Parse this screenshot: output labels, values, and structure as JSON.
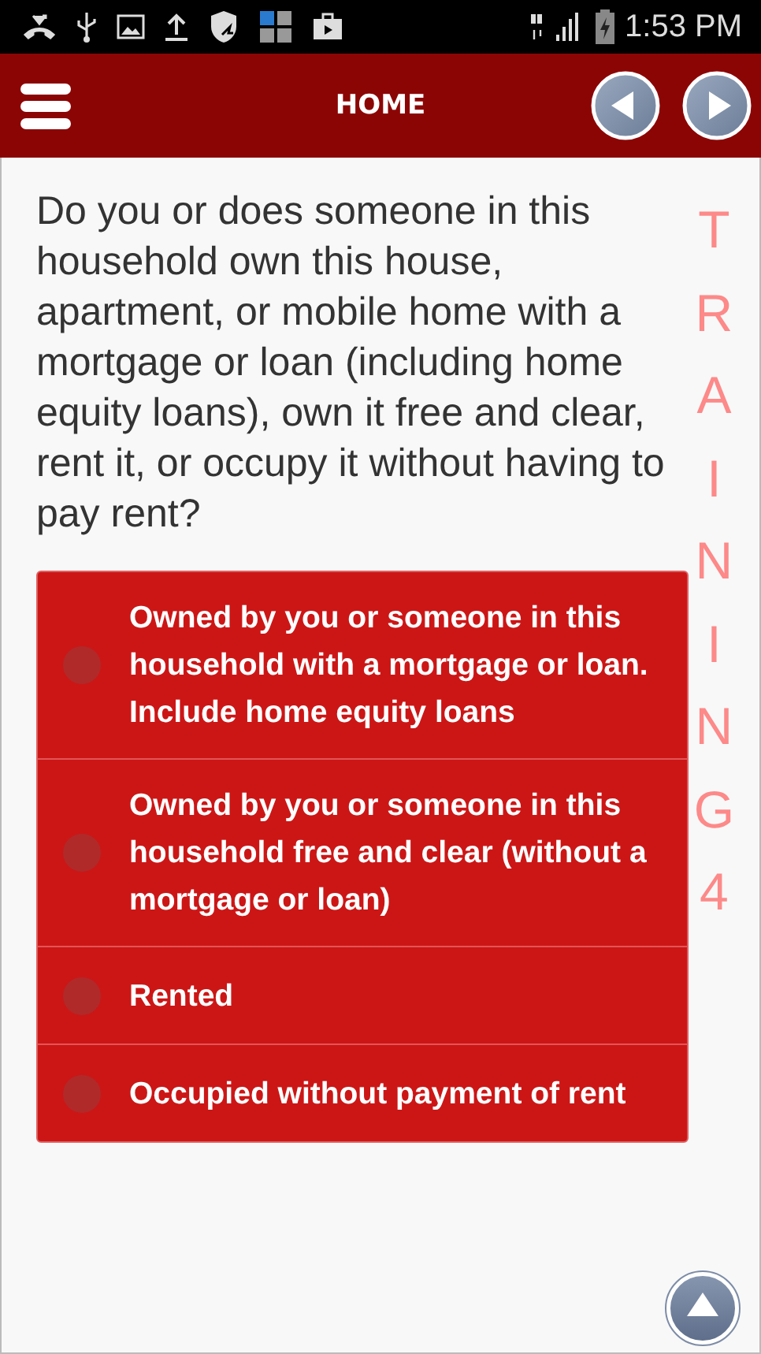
{
  "status_bar": {
    "time": "1:53 PM"
  },
  "header": {
    "title": "HOME"
  },
  "question": "Do you or does someone in this household own this house, apartment, or mobile home with a mortgage or loan (including home equity loans), own it free and clear, rent it, or occupy it without having to pay rent?",
  "options": [
    {
      "label": "Owned by you or someone in this household with a mortgage or loan.  Include home equity loans",
      "selected": false
    },
    {
      "label": "Owned by you or someone in this household free and clear (without a mortgage or loan)",
      "selected": false
    },
    {
      "label": "Rented",
      "selected": false
    },
    {
      "label": "Occupied without payment of rent",
      "selected": false
    }
  ],
  "mode_label": "TRAINING4"
}
